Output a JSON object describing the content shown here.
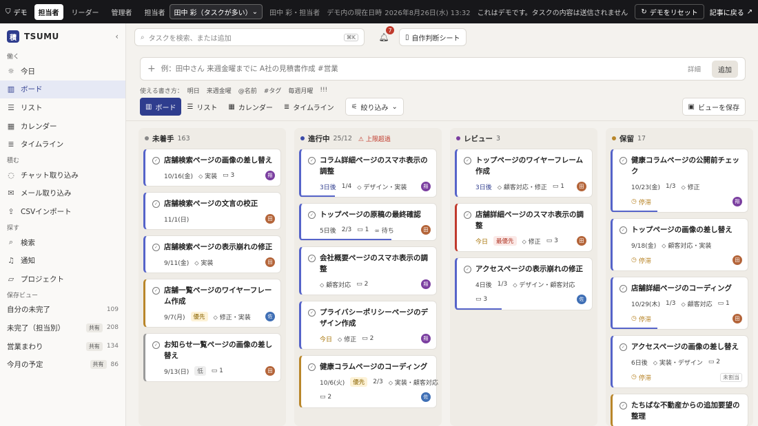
{
  "topbar": {
    "demo": "デモ",
    "roles": [
      "担当者",
      "リーダー",
      "管理者"
    ],
    "assignee_label": "担当者",
    "assignee_value": "田中 彩（タスクが多い）",
    "current_user": "田中 彩・担当者",
    "now_label": "デモ内の現在日時",
    "now_value": "2026年8月26日(水) 13:32",
    "note": "これはデモです。タスクの内容は送信されません",
    "reset": "デモをリセット",
    "back": "記事に戻る"
  },
  "sidebar": {
    "brand": "TSUMU",
    "brand_logo": "積",
    "sections": [
      {
        "label": "働く",
        "items": [
          {
            "icon": "sun-icon",
            "glyph": "☼",
            "label": "今日"
          },
          {
            "icon": "board-icon",
            "glyph": "▥",
            "label": "ボード",
            "active": true
          },
          {
            "icon": "list-icon",
            "glyph": "☰",
            "label": "リスト"
          },
          {
            "icon": "calendar-icon",
            "glyph": "▦",
            "label": "カレンダー"
          },
          {
            "icon": "timeline-icon",
            "glyph": "≣",
            "label": "タイムライン"
          }
        ]
      },
      {
        "label": "積む",
        "items": [
          {
            "icon": "chat-icon",
            "glyph": "◌",
            "label": "チャット取り込み"
          },
          {
            "icon": "mail-icon",
            "glyph": "✉",
            "label": "メール取り込み"
          },
          {
            "icon": "upload-icon",
            "glyph": "⇪",
            "label": "CSVインポート"
          }
        ]
      },
      {
        "label": "探す",
        "items": [
          {
            "icon": "search-icon",
            "glyph": "⌕",
            "label": "検索"
          },
          {
            "icon": "bell-icon",
            "glyph": "♫",
            "label": "通知"
          },
          {
            "icon": "folder-icon",
            "glyph": "▱",
            "label": "プロジェクト"
          }
        ]
      }
    ],
    "saved_label": "保存ビュー",
    "saved_views": [
      {
        "label": "自分の未完了",
        "count": "109"
      },
      {
        "label": "未完了（担当別）",
        "shared": "共有",
        "count": "208"
      },
      {
        "label": "営業まわり",
        "shared": "共有",
        "count": "134"
      },
      {
        "label": "今月の予定",
        "shared": "共有",
        "count": "86"
      }
    ]
  },
  "search": {
    "placeholder": "タスクを検索、または追加",
    "kbd": "⌘K"
  },
  "notifications": {
    "count": "7"
  },
  "sheet_button": "自作判断シート",
  "quick_add": {
    "placeholder": "例：田中さん 来週金曜までに A社の見積書作成 #営業",
    "detail": "詳細",
    "add": "追加"
  },
  "hints": {
    "label": "使える書き方：",
    "items": [
      "明日",
      "来週金曜",
      "@名前",
      "#タグ",
      "毎週月曜",
      "!!!"
    ]
  },
  "views": {
    "tabs": [
      {
        "icon": "board-icon",
        "glyph": "▥",
        "label": "ボード",
        "active": true
      },
      {
        "icon": "list-icon",
        "glyph": "☰",
        "label": "リスト"
      },
      {
        "icon": "calendar-icon",
        "glyph": "▦",
        "label": "カレンダー"
      },
      {
        "icon": "timeline-icon",
        "glyph": "≣",
        "label": "タイムライン"
      }
    ],
    "filter": "絞り込み",
    "save_view": "ビューを保存"
  },
  "colors": {
    "primary": "#2f3d8e",
    "todo": "#888888",
    "doing": "#3b4ba8",
    "review": "#7b3fa0",
    "hold": "#b9862a",
    "danger": "#c0392b"
  },
  "columns": [
    {
      "title": "未着手",
      "count": "163",
      "dot": "#888888",
      "cards": [
        {
          "title": "店舗検索ページの画像の差し替え",
          "due": "10/16(金)",
          "tag": "実装",
          "comments": "3",
          "avatar": "翔",
          "av": "den",
          "bar": "blue"
        },
        {
          "title": "店舗検索ページの文言の校正",
          "due": "11/1(日)",
          "avatar": "田",
          "av": "ta",
          "bar": "blue"
        },
        {
          "title": "店舗検索ページの表示崩れの修正",
          "due": "9/11(金)",
          "tag": "実装",
          "avatar": "田",
          "av": "ta",
          "bar": "blue"
        },
        {
          "title": "店舗一覧ページのワイヤーフレーム作成",
          "due": "9/7(月)",
          "priority": "優先",
          "pri": "mid",
          "tag": "修正・実装",
          "avatar": "佐",
          "av": "sa",
          "bar": "gold"
        },
        {
          "title": "お知らせ一覧ページの画像の差し替え",
          "due": "9/13(日)",
          "priority": "低",
          "pri": "low",
          "comments": "1",
          "avatar": "田",
          "av": "ta",
          "bar": "gray"
        }
      ]
    },
    {
      "title": "進行中",
      "count": "25/12",
      "over": "上限超過",
      "dot": "#3b4ba8",
      "cards": [
        {
          "title": "コラム詳細ページのスマホ表示の調整",
          "due": "3日後",
          "due_style": "blue",
          "progress": "1/4",
          "tag": "デザイン・実装",
          "avatar": "翔",
          "av": "den",
          "bar": "blue",
          "pbar": 0.25
        },
        {
          "title": "トップページの原稿の最終確認",
          "due": "5日後",
          "progress": "2/3",
          "comments": "1",
          "link": "待ち",
          "avatar": "田",
          "av": "ta",
          "bar": "blue",
          "pbar": 0.67
        },
        {
          "title": "会社概要ページのスマホ表示の調整",
          "tag": "顧客対応",
          "comments": "2",
          "avatar": "翔",
          "av": "den",
          "bar": "blue"
        },
        {
          "title": "プライバシーポリシーページのデザイン作成",
          "due": "今日",
          "due_style": "gold",
          "tag": "修正",
          "comments": "2",
          "avatar": "翔",
          "av": "den",
          "bar": "blue"
        },
        {
          "title": "健康コラムページのコーディング",
          "due": "10/6(火)",
          "priority": "優先",
          "pri": "mid",
          "progress": "2/3",
          "tag": "実装・顧客対応",
          "comments": "2",
          "avatar": "佐",
          "av": "sa",
          "bar": "gold",
          "second_line": true
        }
      ]
    },
    {
      "title": "レビュー",
      "count": "3",
      "dot": "#7b3fa0",
      "cards": [
        {
          "title": "トップページのワイヤーフレーム作成",
          "due": "3日後",
          "due_style": "blue",
          "tag": "顧客対応・修正",
          "comments": "1",
          "avatar": "田",
          "av": "ta",
          "bar": "blue"
        },
        {
          "title": "店舗詳細ページのスマホ表示の調整",
          "due": "今日",
          "due_style": "gold",
          "priority": "最優先",
          "pri": "high",
          "tag": "修正",
          "comments": "3",
          "avatar": "田",
          "av": "ta",
          "bar": "red"
        },
        {
          "title": "アクセスページの表示崩れの修正",
          "due": "4日後",
          "progress": "1/3",
          "tag": "デザイン・顧客対応",
          "comments": "3",
          "avatar": "佐",
          "av": "sa",
          "bar": "blue",
          "second_line": true,
          "pbar": 0.33
        }
      ]
    },
    {
      "title": "保留",
      "count": "17",
      "dot": "#b9862a",
      "cards": [
        {
          "title": "健康コラムページの公開前チェック",
          "due": "10/23(金)",
          "progress": "1/3",
          "tag": "修正",
          "stalled": "停滞",
          "avatar": "翔",
          "av": "den",
          "bar": "blue",
          "pbar": 0.33
        },
        {
          "title": "トップページの画像の差し替え",
          "due": "9/18(金)",
          "tag": "顧客対応・実装",
          "stalled": "停滞",
          "avatar": "田",
          "av": "ta",
          "bar": "blue"
        },
        {
          "title": "店舗詳細ページのコーディング",
          "due": "10/29(木)",
          "progress": "1/3",
          "tag": "顧客対応",
          "comments": "1",
          "stalled": "停滞",
          "avatar": "田",
          "av": "ta",
          "bar": "blue",
          "pbar": 0.33
        },
        {
          "title": "アクセスページの画像の差し替え",
          "due": "6日後",
          "tag": "実装・デザイン",
          "comments": "2",
          "stalled": "停滞",
          "unassigned": "未割当",
          "bar": "blue"
        },
        {
          "title": "たちばな不動産からの追加要望の整理",
          "bar": "gold"
        }
      ]
    }
  ]
}
